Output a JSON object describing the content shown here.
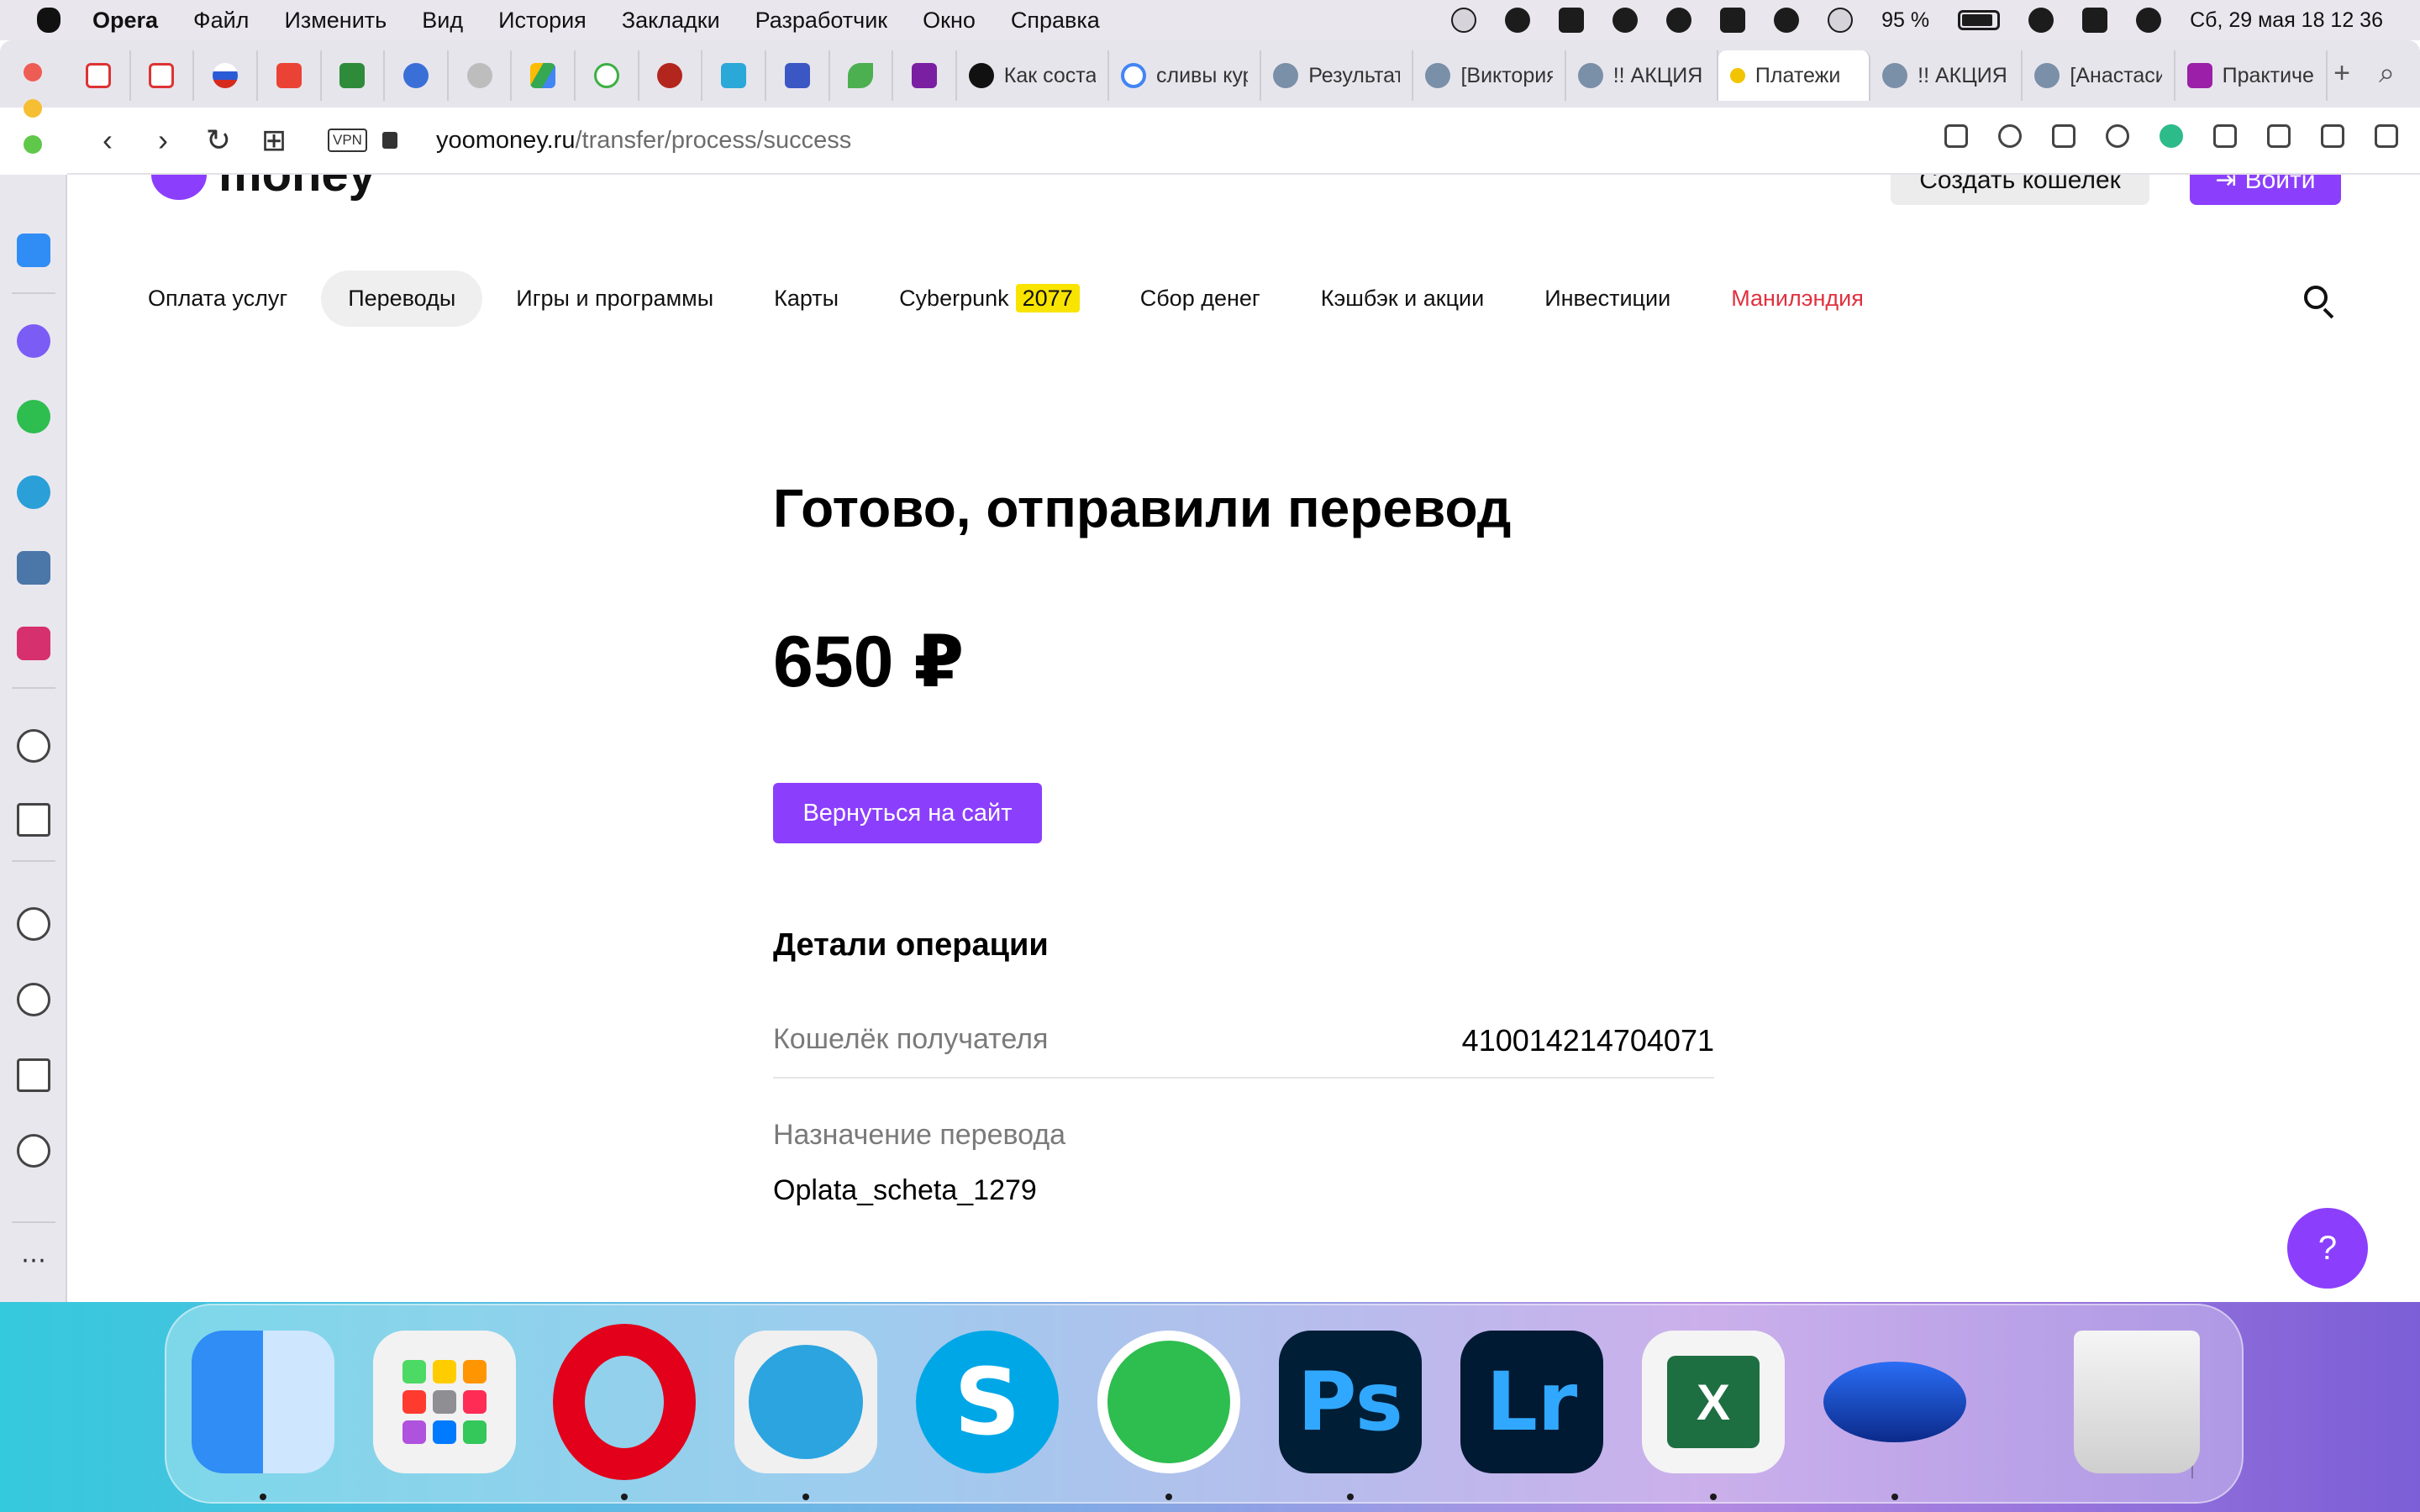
{
  "menubar": {
    "app_name": "Opera",
    "items": [
      "Файл",
      "Изменить",
      "Вид",
      "История",
      "Закладки",
      "Разработчик",
      "Окно",
      "Справка"
    ],
    "battery": "95 %",
    "datetime": "Сб, 29 мая  18 12 36"
  },
  "tabs": {
    "titled": [
      {
        "label": "Как соста"
      },
      {
        "label": "сливы кур"
      },
      {
        "label": "Результат"
      },
      {
        "label": "[Виктория"
      },
      {
        "label": "!! АКЦИЯ"
      },
      {
        "label": "Платежи"
      },
      {
        "label": "!! АКЦИЯ"
      },
      {
        "label": "[Анастаси"
      },
      {
        "label": "Практиче"
      }
    ]
  },
  "address": {
    "vpn": "VPN",
    "domain": "yoomoney.ru",
    "path": "/transfer/process/success"
  },
  "site": {
    "logo_text": "money",
    "create_wallet": "Создать кошелек",
    "login": "Войти",
    "nav": [
      {
        "label": "Оплата услуг"
      },
      {
        "label": "Переводы"
      },
      {
        "label": "Игры и программы"
      },
      {
        "label": "Карты"
      },
      {
        "label": "Cyberpunk"
      },
      {
        "label": "Сбор денег"
      },
      {
        "label": "Кэшбэк и акции"
      },
      {
        "label": "Инвестиции"
      },
      {
        "label": "Манилэндия"
      }
    ],
    "nav_badge": "2077"
  },
  "result": {
    "headline": "Готово, отправили перевод",
    "amount": "650 ₽",
    "return_button": "Вернуться на сайт",
    "details_title": "Детали операции",
    "recipient_label": "Кошелёк получателя",
    "recipient_value": "410014214704071",
    "purpose_label": "Назначение перевода",
    "purpose_value": "Oplata_scheta_1279",
    "help": "?"
  },
  "dock": {
    "ps_label": "Ps",
    "lr_label": "Lr",
    "excel_label": "X"
  },
  "colors": {
    "brand_purple": "#8b3ffd",
    "accent_red": "#e0313f",
    "badge_yellow": "#f9e400"
  }
}
